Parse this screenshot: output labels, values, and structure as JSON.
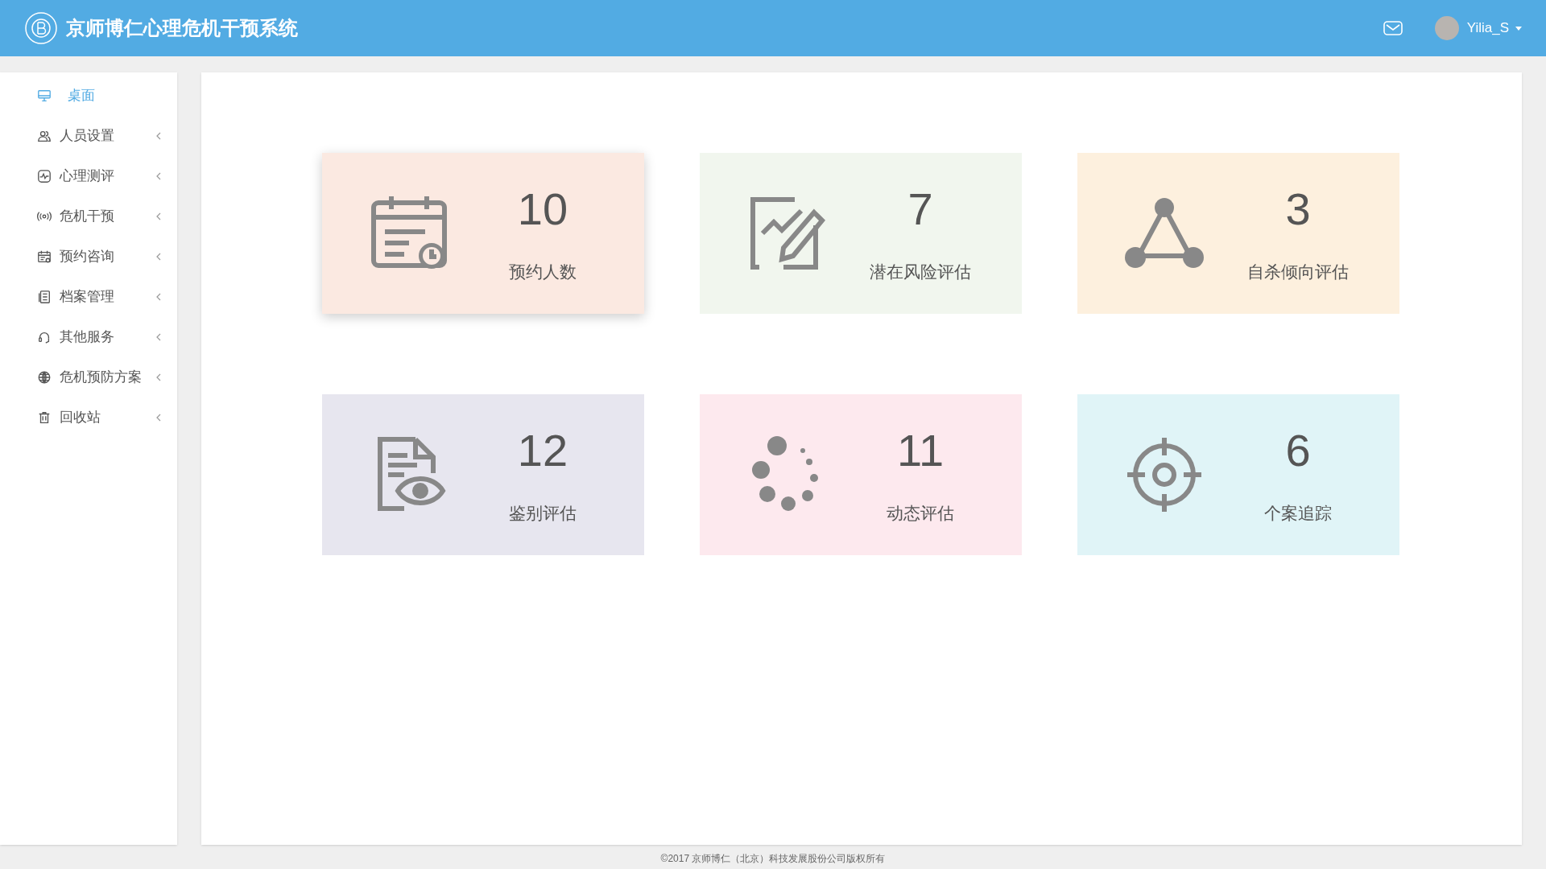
{
  "header": {
    "title": "京师博仁心理危机干预系统",
    "user": "Yilia_S"
  },
  "sidebar": {
    "items": [
      {
        "kind": "monitor",
        "label": "桌面",
        "selected": true,
        "has_submenu": false
      },
      {
        "kind": "people",
        "label": "人员设置",
        "selected": false,
        "has_submenu": true
      },
      {
        "kind": "pulse",
        "label": "心理测评",
        "selected": false,
        "has_submenu": true
      },
      {
        "kind": "signal",
        "label": "危机干预",
        "selected": false,
        "has_submenu": true
      },
      {
        "kind": "calendar",
        "label": "预约咨询",
        "selected": false,
        "has_submenu": true
      },
      {
        "kind": "file",
        "label": "档案管理",
        "selected": false,
        "has_submenu": true
      },
      {
        "kind": "headset",
        "label": "其他服务",
        "selected": false,
        "has_submenu": true
      },
      {
        "kind": "globe",
        "label": "危机预防方案",
        "selected": false,
        "has_submenu": true
      },
      {
        "kind": "trash",
        "label": "回收站",
        "selected": false,
        "has_submenu": true
      }
    ]
  },
  "cards": [
    {
      "kind": "calendar",
      "count": "10",
      "label": "预约人数",
      "color": "#fbe9e1",
      "selected": true
    },
    {
      "kind": "chart",
      "count": "7",
      "label": "潜在风险评估",
      "color": "#f1f6ee",
      "selected": false
    },
    {
      "kind": "triangle",
      "count": "3",
      "label": "自杀倾向评估",
      "color": "#fdf0de",
      "selected": false
    },
    {
      "kind": "eye",
      "count": "12",
      "label": "鉴别评估",
      "color": "#e7e6ef",
      "selected": false
    },
    {
      "kind": "spinner",
      "count": "11",
      "label": "动态评估",
      "color": "#fde9ee",
      "selected": false
    },
    {
      "kind": "target",
      "count": "6",
      "label": "个案追踪",
      "color": "#e0f4f7",
      "selected": false
    }
  ],
  "footer": "©2017 京师博仁（北京）科技发展股份公司版权所有"
}
